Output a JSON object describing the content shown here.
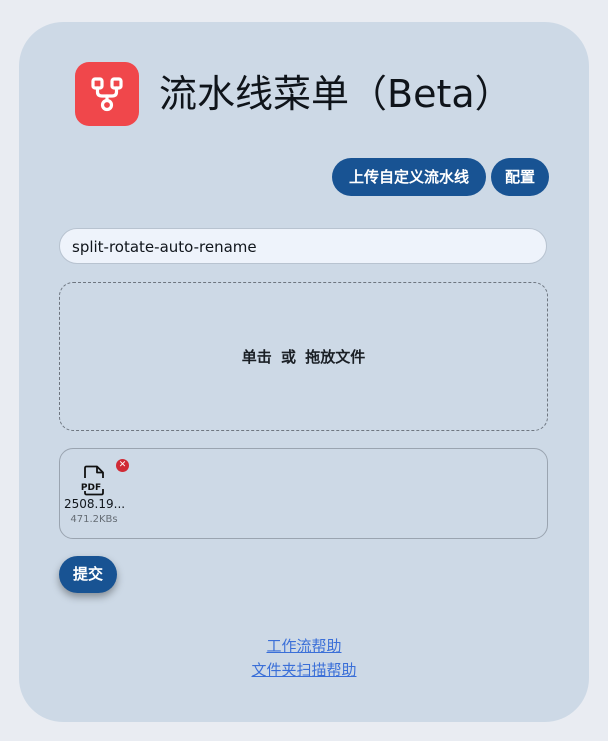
{
  "header": {
    "title": "流水线菜单（Beta）",
    "logo_icon": "pipeline-branch-icon",
    "logo_color": "#f0474b"
  },
  "toolbar": {
    "upload_label": "上传自定义流水线",
    "config_label": "配置",
    "accent_color": "#185393"
  },
  "pipeline": {
    "selected": "split-rotate-auto-rename"
  },
  "dropzone": {
    "text": "单击 或 拖放文件"
  },
  "files": [
    {
      "icon": "pdf-file-icon",
      "type_label": "PDF",
      "name": "2508.19...",
      "size": "471.2KBs"
    }
  ],
  "actions": {
    "submit_label": "提交"
  },
  "links": {
    "workflow_help": "工作流帮助",
    "folder_scan_help": "文件夹扫描帮助"
  }
}
